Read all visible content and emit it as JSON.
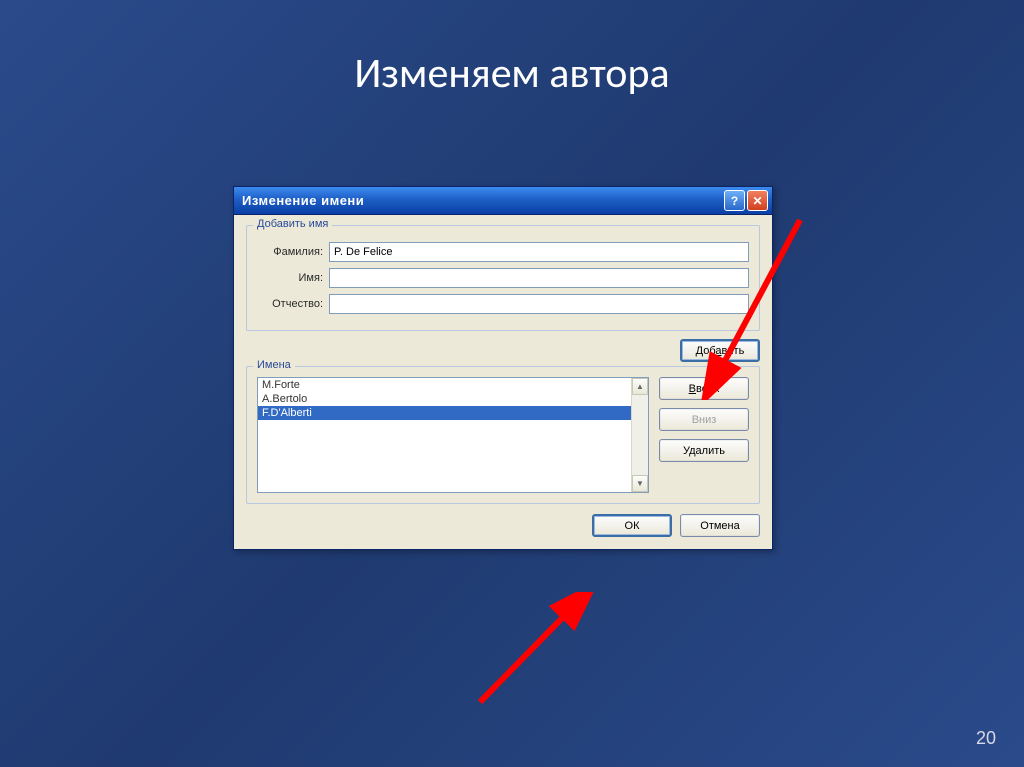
{
  "slide": {
    "title": "Изменяем автора",
    "page_number": "20"
  },
  "dialog": {
    "title": "Изменение имени",
    "group_add": {
      "legend": "Добавить имя",
      "surname_label": "Фамилия:",
      "surname_value": "P. De Felice",
      "name_label": "Имя:",
      "name_value": "",
      "middle_label": "Отчество:",
      "middle_value": ""
    },
    "add_button": "Добавить",
    "group_names": {
      "legend": "Имена",
      "items": [
        "M.Forte",
        "A.Bertolo",
        "F.D'Alberti"
      ],
      "selected_index": 2
    },
    "buttons": {
      "up": "Вверх",
      "down": "Вниз",
      "delete": "Удалить",
      "ok": "ОК",
      "cancel": "Отмена"
    }
  }
}
